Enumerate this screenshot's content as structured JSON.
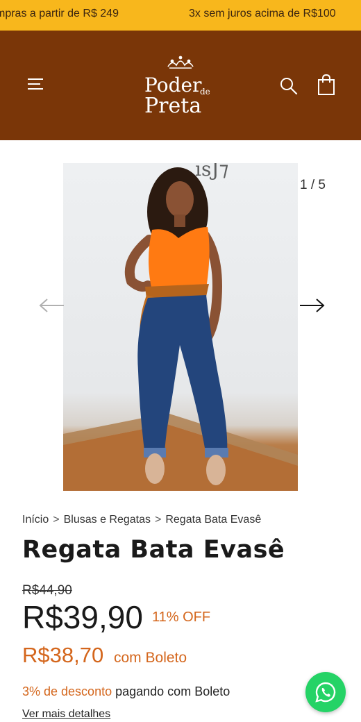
{
  "announcement": {
    "left_text": "mpras a partir de R$ 249",
    "right_text": "3x sem juros acima de R$100"
  },
  "header": {
    "logo_line1": "Poder",
    "logo_de": "de",
    "logo_line2": "Preta",
    "colors": {
      "background": "#7a3608",
      "announcement": "#f8b71c"
    },
    "icons": [
      "menu-icon",
      "search-icon",
      "shopping-bag-icon"
    ]
  },
  "gallery": {
    "counter": "1 / 5",
    "current": 1,
    "total": 5
  },
  "breadcrumb": {
    "items": [
      "Início",
      "Blusas e Regatas",
      "Regata Bata Evasê"
    ],
    "separator": ">"
  },
  "product": {
    "title": "Regata Bata Evasê",
    "old_price": "R$44,90",
    "price": "R$39,90",
    "discount": "11% OFF",
    "boleto_price": "R$38,70",
    "boleto_label": "com Boleto",
    "boleto_discount": "3% de desconto",
    "boleto_text": "pagando com Boleto",
    "details_link": "Ver mais detalhes"
  },
  "theme": {
    "accent": "#d4661c",
    "whatsapp": "#25d366"
  }
}
